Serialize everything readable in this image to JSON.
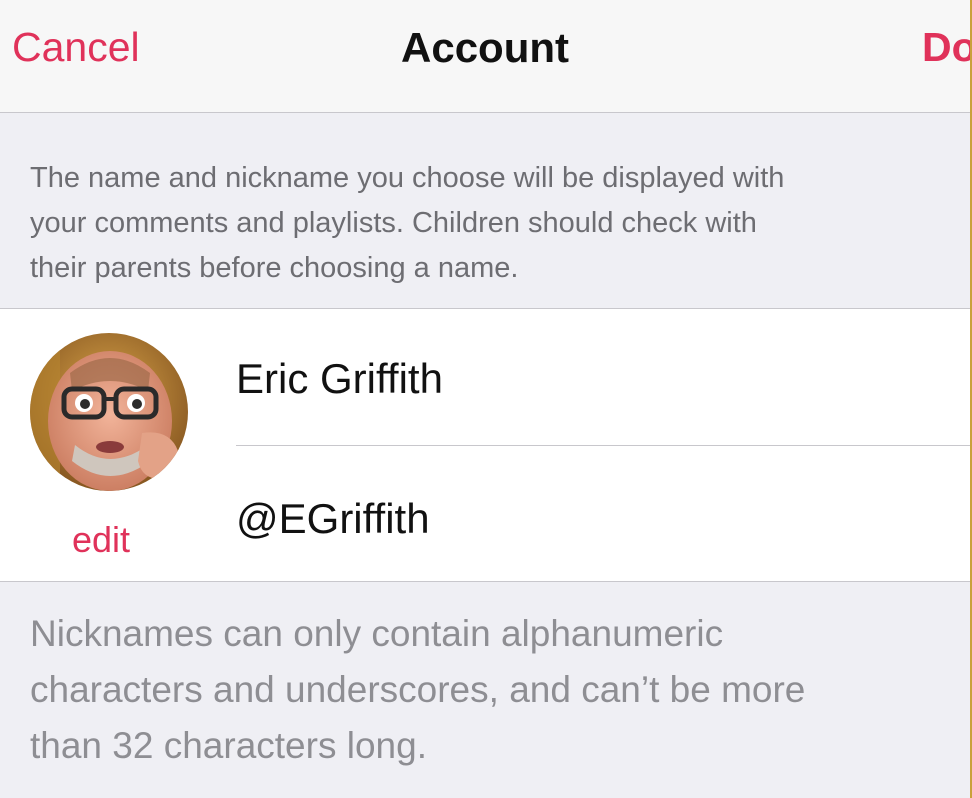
{
  "nav": {
    "cancel_label": "Cancel",
    "title": "Account",
    "done_label": "Do"
  },
  "header_notice": {
    "lines": [
      "The name and nickname you choose will be displayed with",
      "your comments and playlists. Children should check with",
      "their parents before choosing a name."
    ]
  },
  "profile": {
    "edit_label": "edit",
    "name": "Eric Griffith",
    "nickname": "@EGriffith"
  },
  "footer_notice": {
    "lines": [
      "Nicknames can only contain alphanumeric",
      "characters and underscores, and can’t be more",
      "than 32 characters long."
    ]
  },
  "colors": {
    "accent": "#e0325a",
    "background": "#efeff4",
    "separator": "#c8c7cc"
  }
}
